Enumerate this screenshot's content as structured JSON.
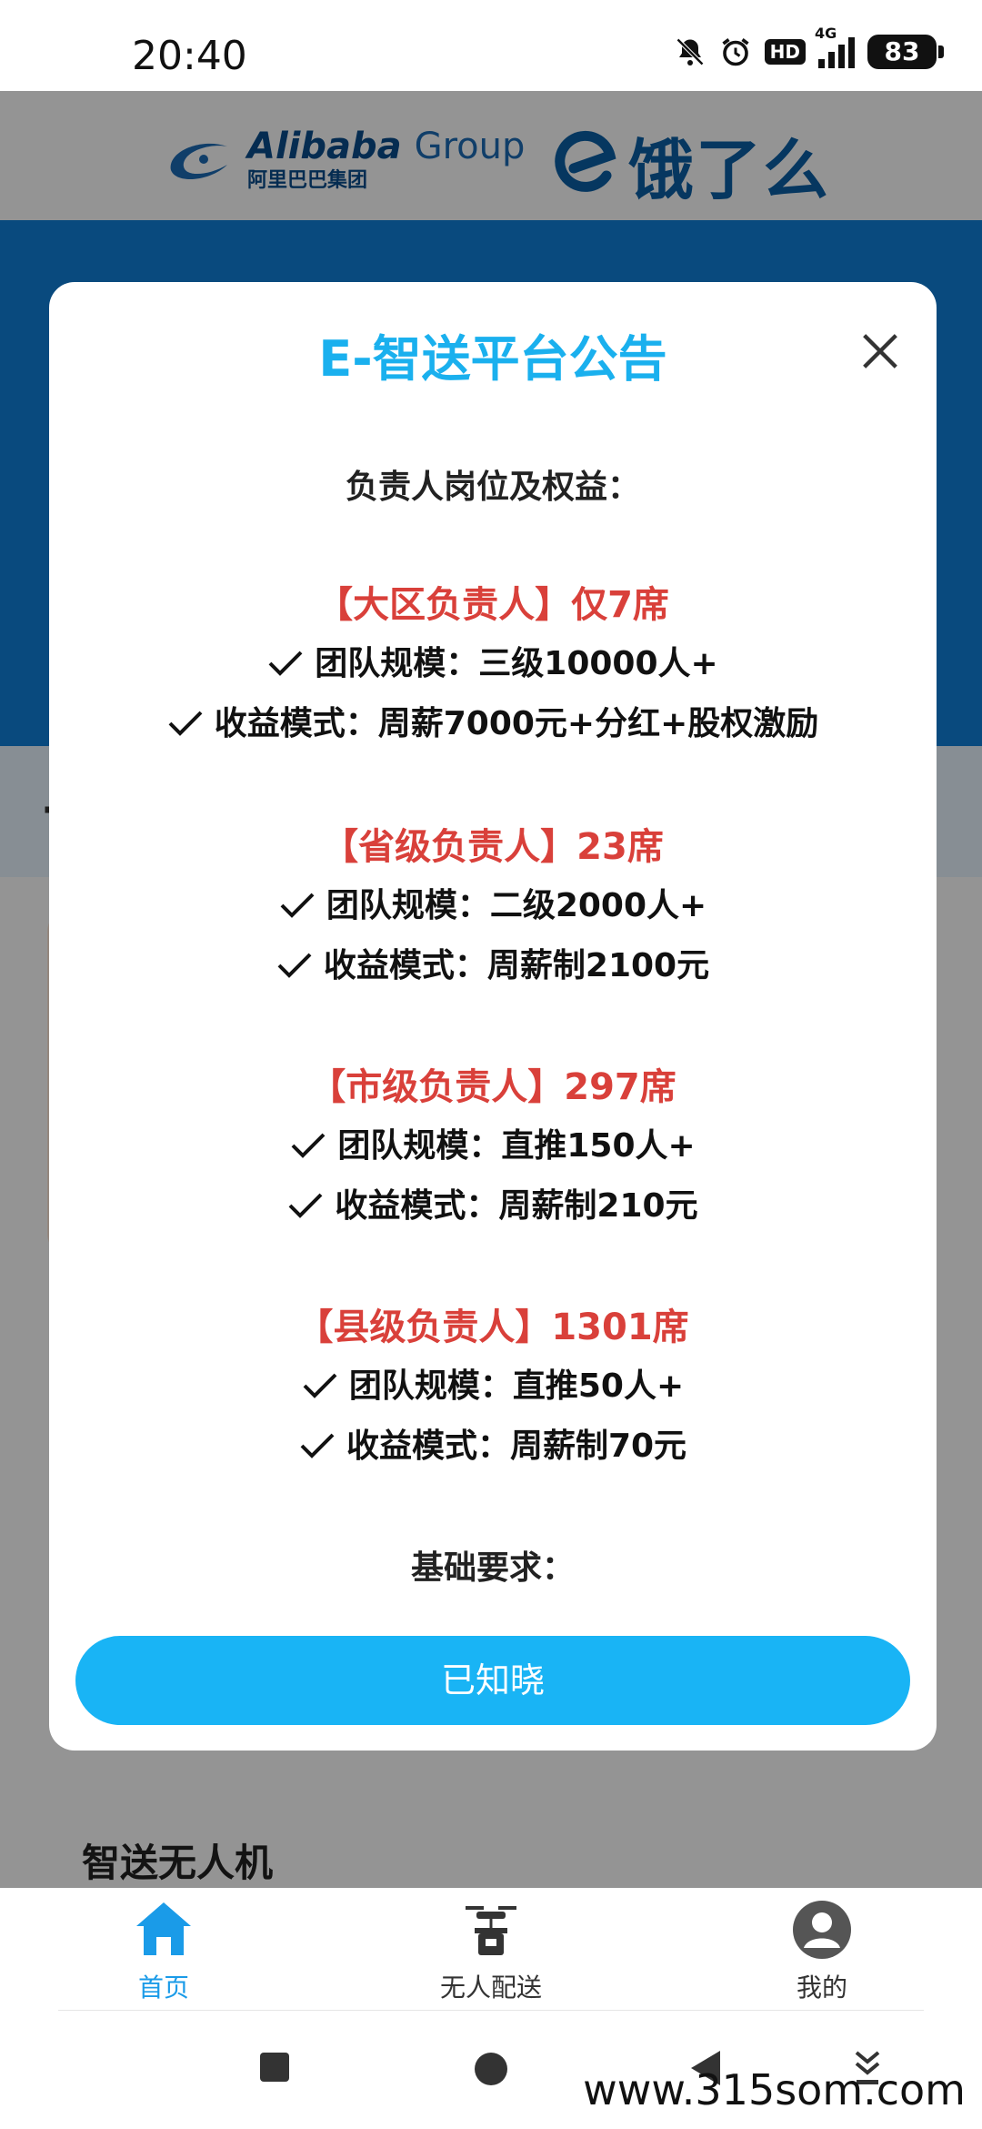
{
  "status_bar": {
    "time": "20:40",
    "hd": "HD",
    "network": "4G",
    "battery": "83"
  },
  "header": {
    "alibaba_en": "Alibaba",
    "alibaba_group": "Group",
    "alibaba_cn": "阿里巴巴集团",
    "eleme": "饿了么"
  },
  "background": {
    "drone_section_title": "智送无人机"
  },
  "modal": {
    "title": "E-智送平台公告",
    "section_positions": "负责人岗位及权益：",
    "tiers": [
      {
        "title": "【大区负责人】仅7席",
        "team": "团队规模：三级10000人+",
        "income": "收益模式：周薪7000元+分红+股权激励"
      },
      {
        "title": "【省级负责人】23席",
        "team": "团队规模：二级2000人+",
        "income": "收益模式：周薪制2100元"
      },
      {
        "title": "【市级负责人】297席",
        "team": "团队规模：直推150人+",
        "income": "收益模式：周薪制210元"
      },
      {
        "title": "【县级负责人】1301席",
        "team": "团队规模：直推50人+",
        "income": "收益模式：周薪制70元"
      }
    ],
    "section_requirements": "基础要求：",
    "ack_button": "已知晓"
  },
  "bottom_nav": {
    "items": [
      {
        "label": "首页",
        "icon": "home-icon",
        "active": true
      },
      {
        "label": "无人配送",
        "icon": "drone-delivery-icon",
        "active": false
      },
      {
        "label": "我的",
        "icon": "profile-icon",
        "active": false
      }
    ]
  },
  "watermark": "www.315som.com",
  "colors": {
    "accent": "#19b4f5",
    "title": "#1ab0ee",
    "tier_red": "#d9403a",
    "banner_blue": "#1080d9"
  }
}
